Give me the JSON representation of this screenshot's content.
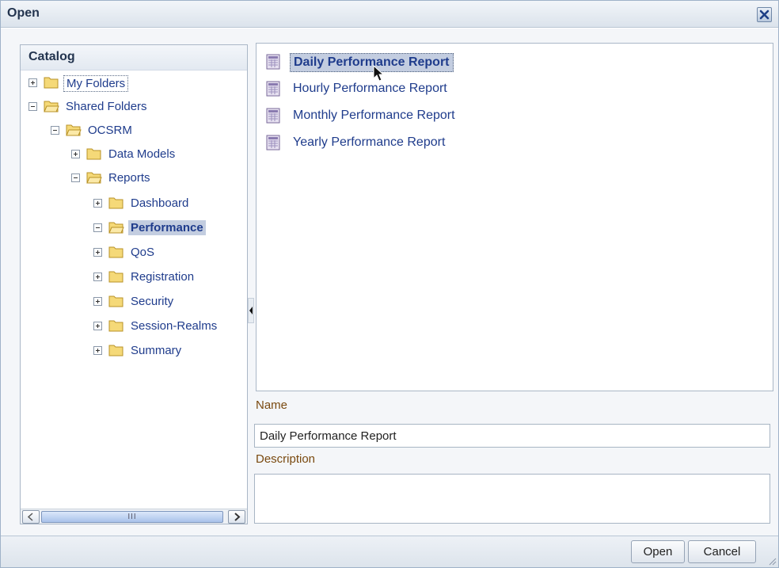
{
  "dialog": {
    "title": "Open",
    "close_icon": "close-icon"
  },
  "catalog": {
    "title": "Catalog",
    "tree": [
      {
        "label": "My Folders",
        "state": "collapsed",
        "level": 0
      },
      {
        "label": "Shared Folders",
        "state": "expanded",
        "level": 0
      },
      {
        "label": "OCSRM",
        "state": "expanded",
        "level": 1
      },
      {
        "label": "Data Models",
        "state": "collapsed",
        "level": 2
      },
      {
        "label": "Reports",
        "state": "expanded",
        "level": 2
      },
      {
        "label": "Dashboard",
        "state": "collapsed",
        "level": 3
      },
      {
        "label": "Performance",
        "state": "expanded",
        "level": 3,
        "selected": true
      },
      {
        "label": "QoS",
        "state": "collapsed",
        "level": 3
      },
      {
        "label": "Registration",
        "state": "collapsed",
        "level": 3
      },
      {
        "label": "Security",
        "state": "collapsed",
        "level": 3
      },
      {
        "label": "Session-Realms",
        "state": "collapsed",
        "level": 3
      },
      {
        "label": "Summary",
        "state": "collapsed",
        "level": 3
      }
    ],
    "scrollbar_grip": "III"
  },
  "files": [
    {
      "label": "Daily Performance Report",
      "selected": true
    },
    {
      "label": "Hourly Performance Report"
    },
    {
      "label": "Monthly Performance Report"
    },
    {
      "label": "Yearly Performance Report"
    }
  ],
  "form": {
    "name_label": "Name",
    "name_value": "Daily Performance Report",
    "description_label": "Description",
    "description_value": ""
  },
  "buttons": {
    "open_label": "Open",
    "cancel_label": "Cancel"
  },
  "colors": {
    "link_text": "#1f3c8c",
    "selection": "#c3cde0",
    "field_label": "#7a4a10"
  }
}
